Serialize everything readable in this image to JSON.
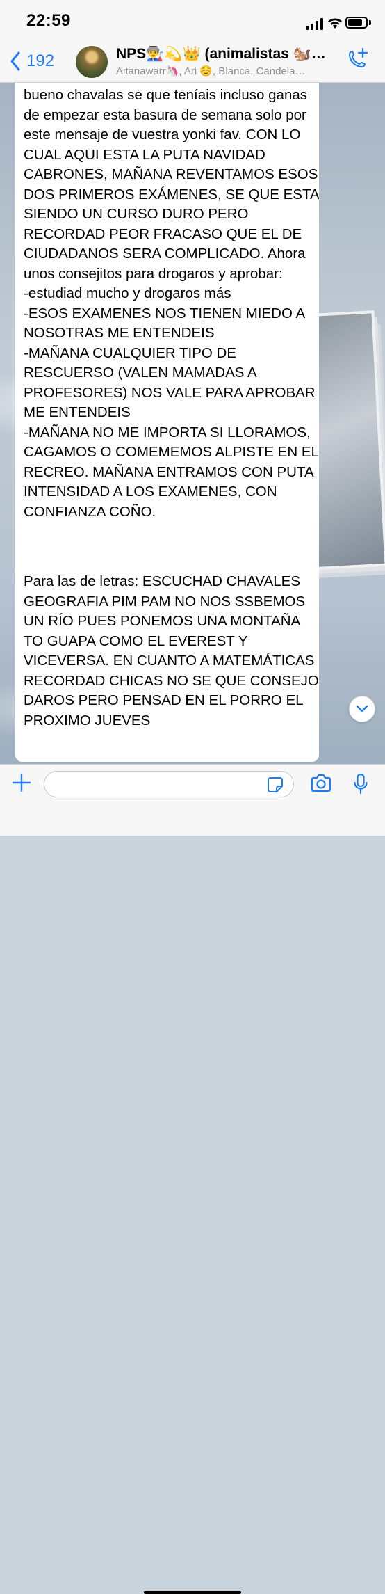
{
  "status_bar": {
    "time": "22:59",
    "battery_level": 0.85
  },
  "header": {
    "back_count": "192",
    "title": "NPS👨‍🏭💫👑 (animalistas 🐿️…",
    "subtitle": "Aitanawarr🦄, Ari ☺️, Blanca, Candela…"
  },
  "messages": [
    {
      "text": "bueno chavalas se que teníais incluso ganas de empezar esta basura de semana solo por este mensaje de vuestra yonki fav. CON LO CUAL AQUI ESTA LA PUTA NAVIDAD CABRONES, MAÑANA REVENTAMOS ESOS DOS PRIMEROS EXÁMENES, SE QUE ESTA SIENDO UN CURSO DURO PERO RECORDAD PEOR FRACASO QUE EL DE CIUDADANOS SERA COMPLICADO. Ahora unos consejitos para drogaros y aprobar:\n-estudiad mucho y drogaros más\n-ESOS EXAMENES NOS TIENEN MIEDO A NOSOTRAS ME ENTENDEIS\n-MAÑANA CUALQUIER TIPO DE RESCUERSO (VALEN MAMADAS A PROFESORES) NOS VALE PARA APROBAR ME ENTENDEIS\n-MAÑANA NO ME IMPORTA SI LLORAMOS, CAGAMOS O COMEMEMOS ALPISTE EN EL RECREO. MAÑANA ENTRAMOS CON PUTA INTENSIDAD A LOS EXAMENES, CON CONFIANZA COÑO."
    },
    {
      "text": "Para las de letras: ESCUCHAD CHAVALES GEOGRAFIA PIM PAM NO NOS SSBEMOS UN RÍO PUES PONEMOS UNA MONTAÑA TO GUAPA COMO EL EVEREST Y VICEVERSA. EN CUANTO A MATEMÁTICAS RECORDAD CHICAS NO SE QUE CONSEJO DAROS PERO PENSAD EN EL PORRO EL PROXIMO JUEVES"
    }
  ],
  "input": {
    "value": "",
    "placeholder": ""
  },
  "icons": {
    "back": "chevron-left-icon",
    "add_call": "phone-plus-icon",
    "scroll_down": "chevron-down-icon",
    "attach": "plus-icon",
    "sticker": "sticker-icon",
    "camera": "camera-icon",
    "mic": "microphone-icon"
  },
  "colors": {
    "accent": "#1d7cf2",
    "bubble": "#ffffff",
    "bar": "#f7f7f7"
  }
}
